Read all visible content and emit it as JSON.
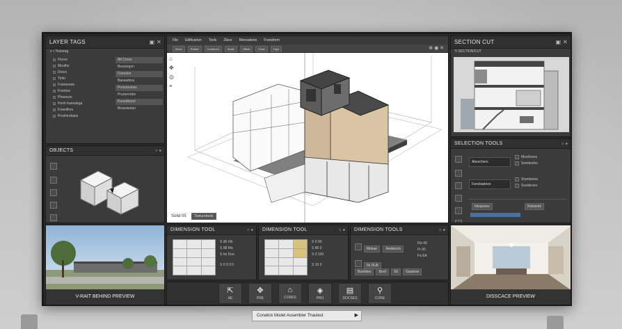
{
  "colors": {
    "accent": "#4a6f9a",
    "panel": "#3b3b3b",
    "viewport": "#ffffff"
  },
  "layer_tags": {
    "title": "LAYER TAGS",
    "header": "≡ • Tectotag",
    "left_items": [
      "Floors",
      "Mouths",
      "Doors",
      "Tinto",
      "Frameswis",
      "Frentiox",
      "Phanocis",
      "Penh framelega",
      "Frunsflors",
      "Proshindrase"
    ],
    "right_items": [
      "Alt Coros",
      "Bessorgon",
      "Fomolon",
      "Bassadoss",
      "Pressoranss",
      "Prunerrolen",
      "Kooodhoroi",
      "Bresswolan"
    ]
  },
  "objects": {
    "title": "OBJECTS"
  },
  "viewport": {
    "menu": [
      "File",
      "Ediftcarion",
      "Tools",
      "Zlace",
      "Mensations",
      "Fransform"
    ],
    "toolbar": [
      "Move",
      "Rotate",
      "Construct",
      "Scale",
      "Offset",
      "Draw",
      "Tape"
    ],
    "status_label": "Solid 05",
    "status_value": "Texturebook"
  },
  "section_cut": {
    "title": "SECTION CUT",
    "subtitle": "5 SECTION/CUT"
  },
  "selection_tools": {
    "title": "SELECTION TOOLS",
    "label_a": "Aboxchers",
    "label_b": "Fancbadoos",
    "rows_a": [
      "Mozhirens",
      "Smrdesfirs"
    ],
    "rows_b": [
      "Stumbores",
      "Sreobroes"
    ],
    "btn_a": "Inkspores",
    "btn_b": "Rotonoto"
  },
  "street_preview": {
    "caption": "V-RAIT BEHIND PREVIEW"
  },
  "interior_preview": {
    "caption": "DISSCACE PREVIEW"
  },
  "bottom_tools": [
    {
      "title": "DIMENSION TOOL",
      "rows": [
        "S d0 r0k",
        "S 98 Ma",
        "S ho Doo"
      ],
      "action": "S 0 0 0 0"
    },
    {
      "title": "DIMENSION TOOL",
      "rows": [
        "S 0 00",
        "S 80 0",
        "S 0 100"
      ],
      "action": "S 10 0"
    },
    {
      "title": "DIMENSION TOOLS",
      "tag1": "Mokae",
      "tag2": "Redoocm",
      "tag3": "5k DU6",
      "val1": "Flo 00",
      "val2": "Fr 00",
      "val3": "Fa EA",
      "buttons": [
        "Bumbles",
        "Bord",
        "S6",
        "Gasdore"
      ]
    }
  ],
  "tool_tiles": [
    {
      "glyph": "⇱",
      "label": "AE"
    },
    {
      "glyph": "✥",
      "label": "PRE"
    },
    {
      "glyph": "⌂",
      "label": "CORES"
    },
    {
      "glyph": "◈",
      "label": "PRO"
    },
    {
      "glyph": "▤",
      "label": "DOCSES"
    },
    {
      "glyph": "⚲",
      "label": "CORE"
    }
  ],
  "bottom_bar": {
    "text": "Conatick Model Assembler Thaulest",
    "play": "▶"
  }
}
